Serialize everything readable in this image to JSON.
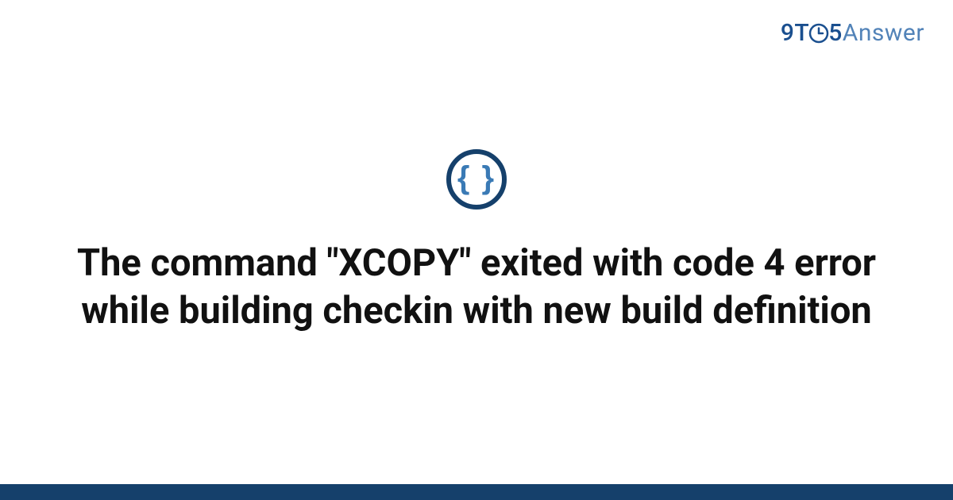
{
  "brand": {
    "nine": "9",
    "t": "T",
    "five": "5",
    "answer": "Answer"
  },
  "icon": {
    "braces": "{ }"
  },
  "title": "The command \"XCOPY\" exited with code 4 error while building checkin with new build definition"
}
